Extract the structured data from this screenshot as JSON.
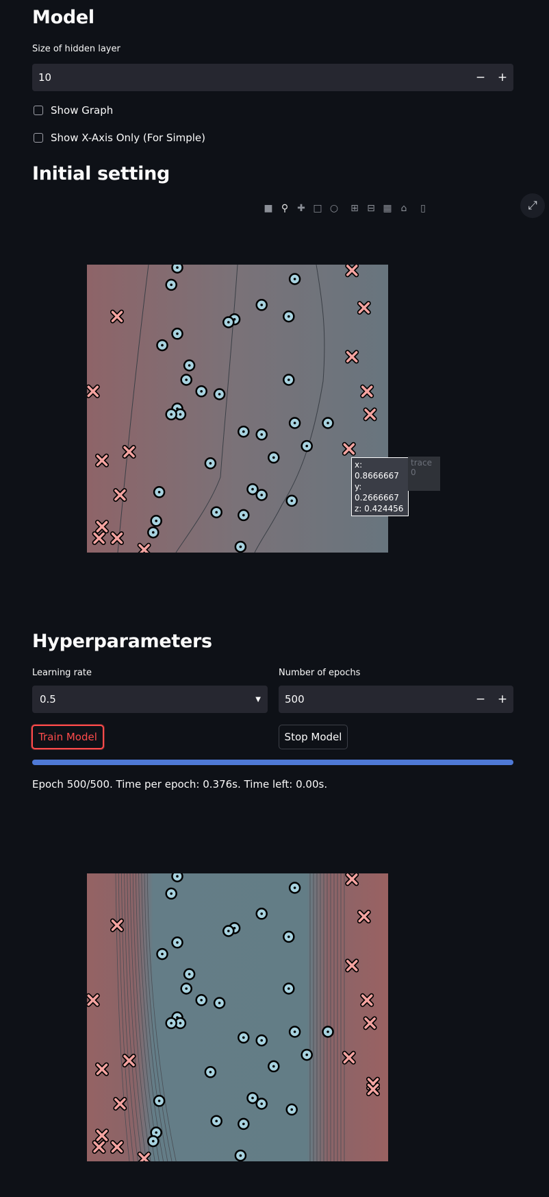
{
  "model": {
    "title": "Model",
    "hidden_label": "Size of hidden layer",
    "hidden_value": "10",
    "minus": "−",
    "plus": "+",
    "show_graph": "Show Graph",
    "show_xaxis": "Show X-Axis Only (For Simple)"
  },
  "initial": {
    "title": "Initial setting",
    "tooltip": {
      "x": "x: 0.8666667",
      "y": "y: 0.2666667",
      "z": "z: 0.424456",
      "trace": "trace 0"
    }
  },
  "modebar_icons": [
    "camera-icon",
    "zoom-icon",
    "pan-icon",
    "box-select-icon",
    "lasso-icon",
    "zoom-in-icon",
    "zoom-out-icon",
    "autoscale-icon",
    "home-icon",
    "plotly-logo-icon"
  ],
  "hyper": {
    "title": "Hyperparameters",
    "lr_label": "Learning rate",
    "lr_value": "0.5",
    "epochs_label": "Number of epochs",
    "epochs_value": "500",
    "train": "Train Model",
    "stop": "Stop Model",
    "progress": 1.0,
    "status": "Epoch 500/500. Time per epoch: 0.376s. Time left: 0.00s."
  },
  "chart_data": [
    {
      "type": "scatter",
      "title": "",
      "xlim": [
        0,
        1
      ],
      "ylim": [
        0,
        1
      ],
      "colors": {
        "class0": "#a8d3e0",
        "class1": "#f4a3a0"
      },
      "class0_points": [
        [
          0.3,
          0.99
        ],
        [
          0.28,
          0.93
        ],
        [
          0.69,
          0.95
        ],
        [
          0.58,
          0.86
        ],
        [
          0.49,
          0.81
        ],
        [
          0.47,
          0.8
        ],
        [
          0.67,
          0.82
        ],
        [
          0.3,
          0.76
        ],
        [
          0.25,
          0.72
        ],
        [
          0.34,
          0.65
        ],
        [
          0.33,
          0.6
        ],
        [
          0.38,
          0.56
        ],
        [
          0.44,
          0.55
        ],
        [
          0.3,
          0.5
        ],
        [
          0.31,
          0.48
        ],
        [
          0.28,
          0.48
        ],
        [
          0.67,
          0.6
        ],
        [
          0.69,
          0.45
        ],
        [
          0.8,
          0.45
        ],
        [
          0.52,
          0.42
        ],
        [
          0.58,
          0.41
        ],
        [
          0.73,
          0.37
        ],
        [
          0.62,
          0.33
        ],
        [
          0.41,
          0.31
        ],
        [
          0.24,
          0.21
        ],
        [
          0.55,
          0.22
        ],
        [
          0.58,
          0.2
        ],
        [
          0.68,
          0.18
        ],
        [
          0.43,
          0.14
        ],
        [
          0.52,
          0.13
        ],
        [
          0.23,
          0.11
        ],
        [
          0.22,
          0.07
        ],
        [
          0.51,
          0.02
        ]
      ],
      "class1_points": [
        [
          0.88,
          0.98
        ],
        [
          0.92,
          0.85
        ],
        [
          0.1,
          0.82
        ],
        [
          0.88,
          0.68
        ],
        [
          0.02,
          0.56
        ],
        [
          0.93,
          0.56
        ],
        [
          0.94,
          0.48
        ],
        [
          0.14,
          0.35
        ],
        [
          0.87,
          0.36
        ],
        [
          0.05,
          0.32
        ],
        [
          0.11,
          0.2
        ],
        [
          0.05,
          0.09
        ],
        [
          0.04,
          0.05
        ],
        [
          0.1,
          0.05
        ],
        [
          0.19,
          0.01
        ]
      ],
      "contour_levels": 3
    },
    {
      "type": "scatter",
      "title": "",
      "xlim": [
        0,
        1
      ],
      "ylim": [
        0,
        1
      ],
      "colors": {
        "class0": "#a8d3e0",
        "class1": "#f4a3a0"
      },
      "class0_points": [
        [
          0.3,
          0.99
        ],
        [
          0.28,
          0.93
        ],
        [
          0.69,
          0.95
        ],
        [
          0.58,
          0.86
        ],
        [
          0.49,
          0.81
        ],
        [
          0.47,
          0.8
        ],
        [
          0.67,
          0.78
        ],
        [
          0.3,
          0.76
        ],
        [
          0.25,
          0.72
        ],
        [
          0.34,
          0.65
        ],
        [
          0.33,
          0.6
        ],
        [
          0.38,
          0.56
        ],
        [
          0.44,
          0.55
        ],
        [
          0.3,
          0.5
        ],
        [
          0.31,
          0.48
        ],
        [
          0.28,
          0.48
        ],
        [
          0.67,
          0.6
        ],
        [
          0.69,
          0.45
        ],
        [
          0.8,
          0.45
        ],
        [
          0.52,
          0.43
        ],
        [
          0.58,
          0.42
        ],
        [
          0.73,
          0.37
        ],
        [
          0.62,
          0.33
        ],
        [
          0.41,
          0.31
        ],
        [
          0.24,
          0.21
        ],
        [
          0.55,
          0.22
        ],
        [
          0.58,
          0.2
        ],
        [
          0.68,
          0.18
        ],
        [
          0.43,
          0.14
        ],
        [
          0.52,
          0.13
        ],
        [
          0.23,
          0.1
        ],
        [
          0.22,
          0.07
        ],
        [
          0.51,
          0.02
        ]
      ],
      "class1_points": [
        [
          0.88,
          0.98
        ],
        [
          0.92,
          0.85
        ],
        [
          0.1,
          0.82
        ],
        [
          0.88,
          0.68
        ],
        [
          0.02,
          0.56
        ],
        [
          0.93,
          0.56
        ],
        [
          0.94,
          0.48
        ],
        [
          0.14,
          0.35
        ],
        [
          0.87,
          0.36
        ],
        [
          0.05,
          0.32
        ],
        [
          0.95,
          0.27
        ],
        [
          0.95,
          0.25
        ],
        [
          0.11,
          0.2
        ],
        [
          0.05,
          0.09
        ],
        [
          0.04,
          0.05
        ],
        [
          0.1,
          0.05
        ],
        [
          0.19,
          0.01
        ]
      ],
      "contour_levels": 20
    }
  ]
}
